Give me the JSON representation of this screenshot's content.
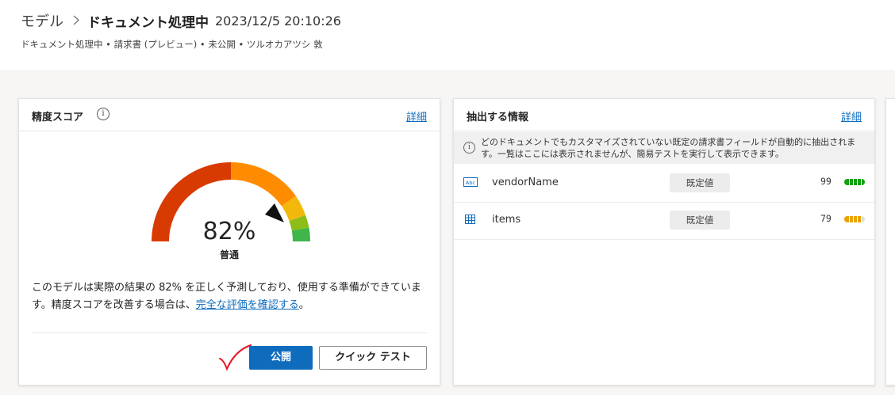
{
  "header": {
    "breadcrumb_parent": "モデル",
    "breadcrumb_separator": ">",
    "title": "ドキュメント処理中",
    "timestamp": "2023/12/5 20:10:26",
    "subtitle": "ドキュメント処理中 • 請求書 (プレビュー) • 未公開 • ツルオカアツシ 敦"
  },
  "accuracy_card": {
    "title": "精度スコア",
    "info_icon": "i",
    "detail_link": "詳細",
    "score": "82%",
    "score_value": 82,
    "level": "普通",
    "desc_text": "このモデルは実際の結果の 82% を正しく予測しており、使用する準備ができています。精度スコアを改善する場合は、",
    "desc_link": "完全な評価を確認する",
    "desc_end": "。",
    "publish_button": "公開",
    "quick_test_button": "クイック テスト"
  },
  "extract_card": {
    "title": "抽出する情報",
    "detail_link": "詳細",
    "info_icon": "i",
    "banner": "どのドキュメントでもカスタマイズされていない既定の請求書フィールドが自動的に抽出されます。一覧はここには表示されませんが、簡易テストを実行して表示できます。",
    "fields": [
      {
        "icon": "text-field-icon",
        "icon_label": "Abc",
        "name": "vendorName",
        "tag": "既定値",
        "score": "99",
        "score_color": "#13a10e"
      },
      {
        "icon": "table-icon",
        "name": "items",
        "tag": "既定値",
        "score": "79",
        "score_color": "#eaa300"
      }
    ]
  },
  "colors": {
    "accent": "#0f6cbd",
    "gauge_red": "#d83b01",
    "gauge_orange": "#ff8c00",
    "gauge_yellow": "#f2b90c",
    "gauge_yellowgreen": "#8cbd18",
    "gauge_green": "#3fb54a",
    "checkmark": "#e81123"
  }
}
